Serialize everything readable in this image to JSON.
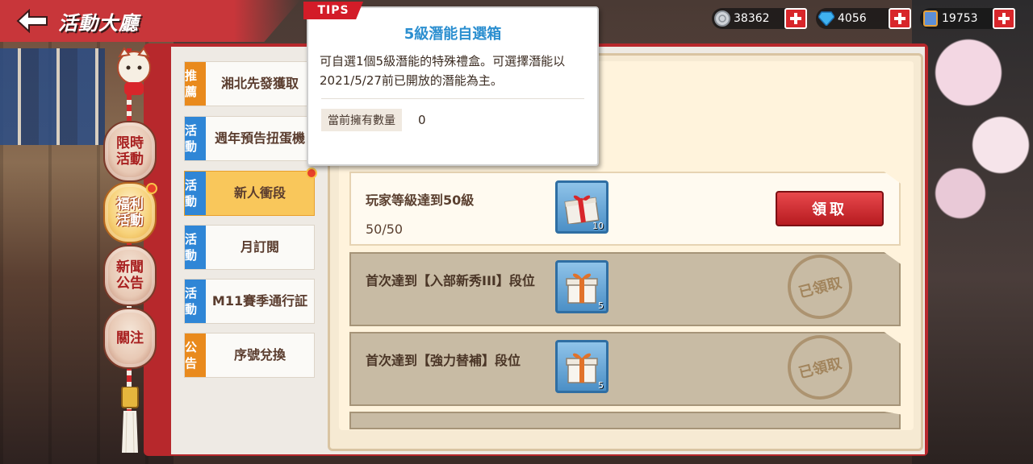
{
  "header": {
    "title": "活動大廳"
  },
  "currencies": [
    {
      "name": "silver-coin",
      "value": "38362"
    },
    {
      "name": "diamond",
      "value": "4056"
    },
    {
      "name": "card",
      "value": "19753"
    }
  ],
  "side_menu": [
    {
      "label": "限時活動",
      "active": false
    },
    {
      "label": "福利活動",
      "active": true
    },
    {
      "label": "新聞公告",
      "active": false
    },
    {
      "label": "關注",
      "active": false
    }
  ],
  "categories": [
    {
      "tag": "推薦",
      "label": "湘北先發獲取",
      "color": "orange"
    },
    {
      "tag": "活動",
      "label": "週年預告扭蛋機",
      "color": "blue"
    },
    {
      "tag": "活動",
      "label": "新人衝段",
      "color": "blue",
      "selected": true
    },
    {
      "tag": "活動",
      "label": "月訂閱",
      "color": "blue"
    },
    {
      "tag": "活動",
      "label": "M11賽季通行証",
      "color": "blue"
    },
    {
      "tag": "公告",
      "label": "序號兌換",
      "color": "orange"
    }
  ],
  "tasks": [
    {
      "desc": "玩家等級達到50級",
      "progress": "50/50",
      "qty": "10",
      "status": "claimable",
      "button": "領取"
    },
    {
      "desc": "首次達到【入部新秀III】段位",
      "qty": "5",
      "status": "claimed",
      "stamp": "已領取"
    },
    {
      "desc": "首次達到【強力替補】段位",
      "qty": "5",
      "status": "claimed",
      "stamp": "已領取"
    }
  ],
  "tooltip": {
    "tag": "TIPS",
    "title": "5級潛能自選箱",
    "desc": "可自選1個5級潛能的特殊禮盒。可選擇潛能以2021/5/27前已開放的潛能為主。",
    "owned_label": "當前擁有數量",
    "owned_value": "0"
  },
  "colors": {
    "frame_red": "#b7282c",
    "tip_title": "#2c8fd0",
    "claim_button": "#d8262b"
  }
}
